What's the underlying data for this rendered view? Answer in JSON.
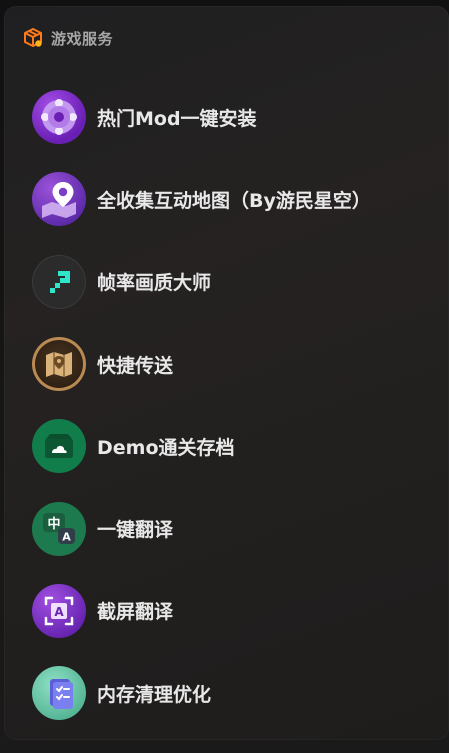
{
  "header": {
    "title": "游戏服务",
    "icon": "game-box-icon",
    "accent": "#ff7a1a"
  },
  "items": [
    {
      "label": "热门Mod一键安装",
      "icon": "mod-gear-icon",
      "color": "#8a36d4"
    },
    {
      "label": "全收集互动地图（By游民星空）",
      "icon": "map-pin-icon",
      "color": "#7b3fc6"
    },
    {
      "label": "帧率画质大师",
      "icon": "fps-arrow-icon",
      "color": "#2b2b2c"
    },
    {
      "label": "快捷传送",
      "icon": "teleport-map-icon",
      "color": "#b98a52"
    },
    {
      "label": "Demo通关存档",
      "icon": "save-folder-icon",
      "color": "#117d4b"
    },
    {
      "label": "一键翻译",
      "icon": "translate-chat-icon",
      "color": "#1d7a4f"
    },
    {
      "label": "截屏翻译",
      "icon": "screenshot-translate-icon",
      "color": "#8a3fd0"
    },
    {
      "label": "内存清理优化",
      "icon": "memory-clean-icon",
      "color": "#5ec3a0"
    }
  ]
}
